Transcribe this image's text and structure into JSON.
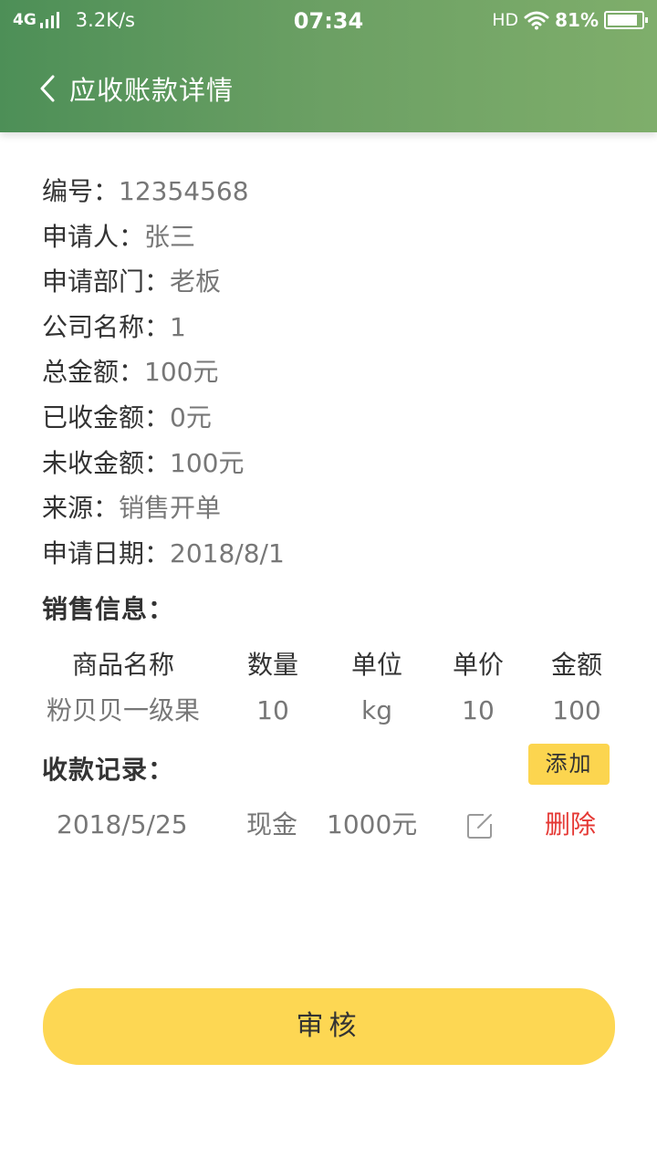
{
  "status_bar": {
    "network": "4G",
    "speed": "3.2K/s",
    "time": "07:34",
    "hd": "HD",
    "battery": "81%"
  },
  "nav": {
    "title": "应收账款详情",
    "back_icon": "chevron-left-icon"
  },
  "details": [
    {
      "label": "编号：",
      "value": "12354568"
    },
    {
      "label": "申请人：",
      "value": "张三"
    },
    {
      "label": "申请部门：",
      "value": "老板"
    },
    {
      "label": "公司名称：",
      "value": "1"
    },
    {
      "label": "总金额：",
      "value": "100元"
    },
    {
      "label": "已收金额：",
      "value": "0元"
    },
    {
      "label": "未收金额：",
      "value": "100元"
    },
    {
      "label": "来源：",
      "value": "销售开单"
    },
    {
      "label": "申请日期：",
      "value": "2018/8/1"
    }
  ],
  "sales": {
    "title": "销售信息：",
    "columns": [
      "商品名称",
      "数量",
      "单位",
      "单价",
      "金额"
    ],
    "rows": [
      [
        "粉贝贝一级果",
        "10",
        "kg",
        "10",
        "100"
      ]
    ]
  },
  "payments": {
    "title": "收款记录：",
    "add_label": "添加",
    "records": [
      {
        "date": "2018/5/25",
        "method": "现金",
        "amount": "1000元",
        "delete_label": "删除",
        "edit_icon": "edit-icon"
      }
    ]
  },
  "audit_label": "审核",
  "colors": {
    "header_start": "#4d8f57",
    "header_end": "#7fae6b",
    "accent": "#fdd753",
    "delete": "#e53935"
  }
}
